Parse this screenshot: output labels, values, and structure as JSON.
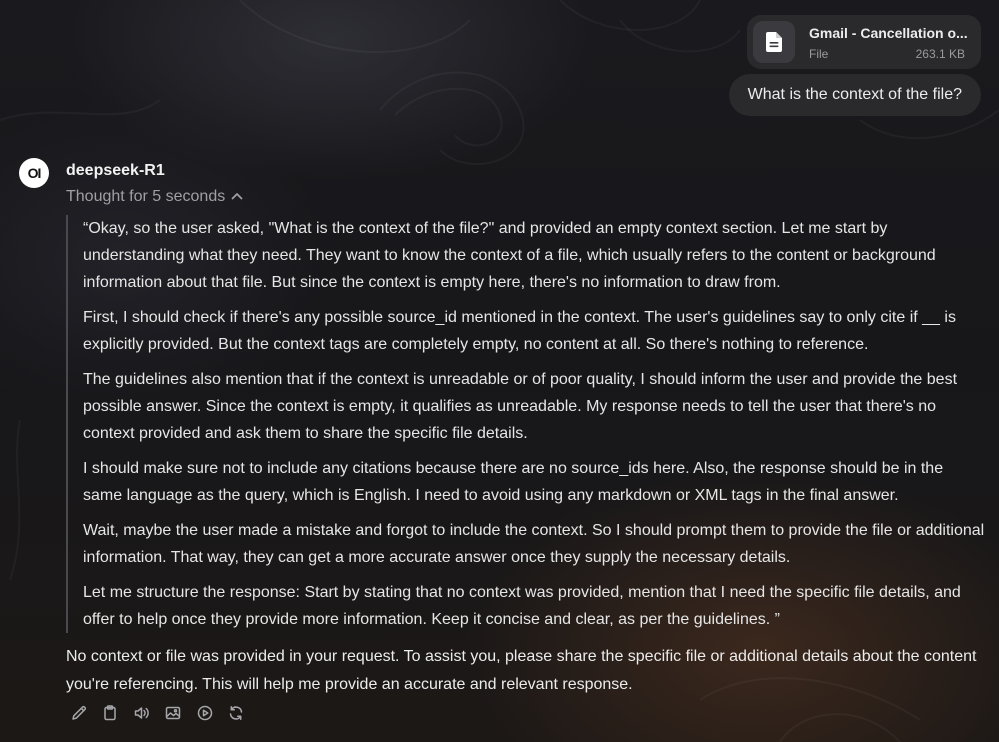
{
  "attachment": {
    "name": "Gmail - Cancellation o...",
    "type": "File",
    "size": "263.1 KB",
    "icon": "document-icon"
  },
  "user_message": {
    "text": "What is the context of the file?"
  },
  "assistant": {
    "avatar_text": "OI",
    "model_name": "deepseek-R1",
    "thought_label": "Thought for 5 seconds",
    "thought_paragraphs": [
      "“Okay, so the user asked, \"What is the context of the file?\" and provided an empty context section. Let me start by understanding what they need. They want to know the context of a file, which usually refers to the content or background information about that file. But since the context is empty here, there's no information to draw from.",
      "First, I should check if there's any possible source_id mentioned in the context. The user's guidelines say to only cite if __ is explicitly provided. But the context tags are completely empty, no content at all. So there's nothing to reference.",
      "The guidelines also mention that if the context is unreadable or of poor quality, I should inform the user and provide the best possible answer. Since the context is empty, it qualifies as unreadable. My response needs to tell the user that there's no context provided and ask them to share the specific file details.",
      "I should make sure not to include any citations because there are no source_ids here. Also, the response should be in the same language as the query, which is English. I need to avoid using any markdown or XML tags in the final answer.",
      "Wait, maybe the user made a mistake and forgot to include the context. So I should prompt them to provide the file or additional information. That way, they can get a more accurate answer once they supply the necessary details.",
      "Let me structure the response: Start by stating that no context was provided, mention that I need the specific file details, and offer to help once they provide more information. Keep it concise and clear, as per the guidelines. ”"
    ],
    "answer": "No context or file was provided in your request. To assist you, please share the specific file or additional details about the content you're referencing. This will help me provide an accurate and relevant response.",
    "actions": [
      "edit-icon",
      "copy-icon",
      "speaker-icon",
      "image-icon",
      "play-icon",
      "regenerate-icon"
    ]
  }
}
